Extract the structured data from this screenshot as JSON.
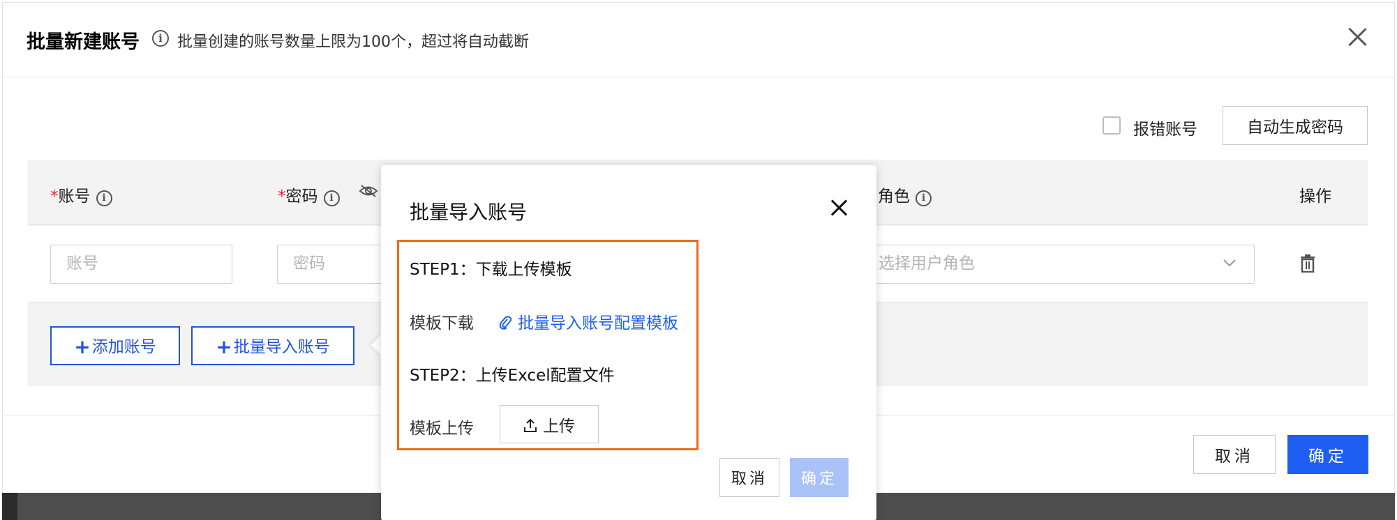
{
  "dialog": {
    "title": "批量新建账号",
    "tip": "批量创建的账号数量上限为100个，超过将自动截断",
    "close_icon": "close-icon"
  },
  "toolbar": {
    "error_checkbox_label": "报错账号",
    "error_checkbox_checked": false,
    "auto_password_button": "自动生成密码"
  },
  "table": {
    "columns": [
      {
        "label": "账号",
        "required": true
      },
      {
        "label": "密码",
        "required": true
      },
      {
        "label": "角色",
        "required": false
      },
      {
        "label": "操作",
        "required": false
      }
    ],
    "row": {
      "account_placeholder": "账号",
      "password_placeholder": "密码",
      "role_placeholder": "选择用户角色"
    },
    "add_account_button": "添加账号",
    "batch_import_button": "批量导入账号"
  },
  "footer": {
    "cancel": "取消",
    "confirm": "确定"
  },
  "popover": {
    "title": "批量导入账号",
    "step1": "STEP1：下载上传模板",
    "template_download_label": "模板下载",
    "template_link": "批量导入账号配置模板",
    "step2": "STEP2：上传Excel配置文件",
    "template_upload_label": "模板上传",
    "upload_button": "上传",
    "cancel": "取消",
    "confirm": "确定"
  },
  "colors": {
    "primary": "#1f5ef2",
    "primary_disabled": "#a9c2f7",
    "highlight_border": "#f26b14",
    "required": "#e0232e"
  }
}
